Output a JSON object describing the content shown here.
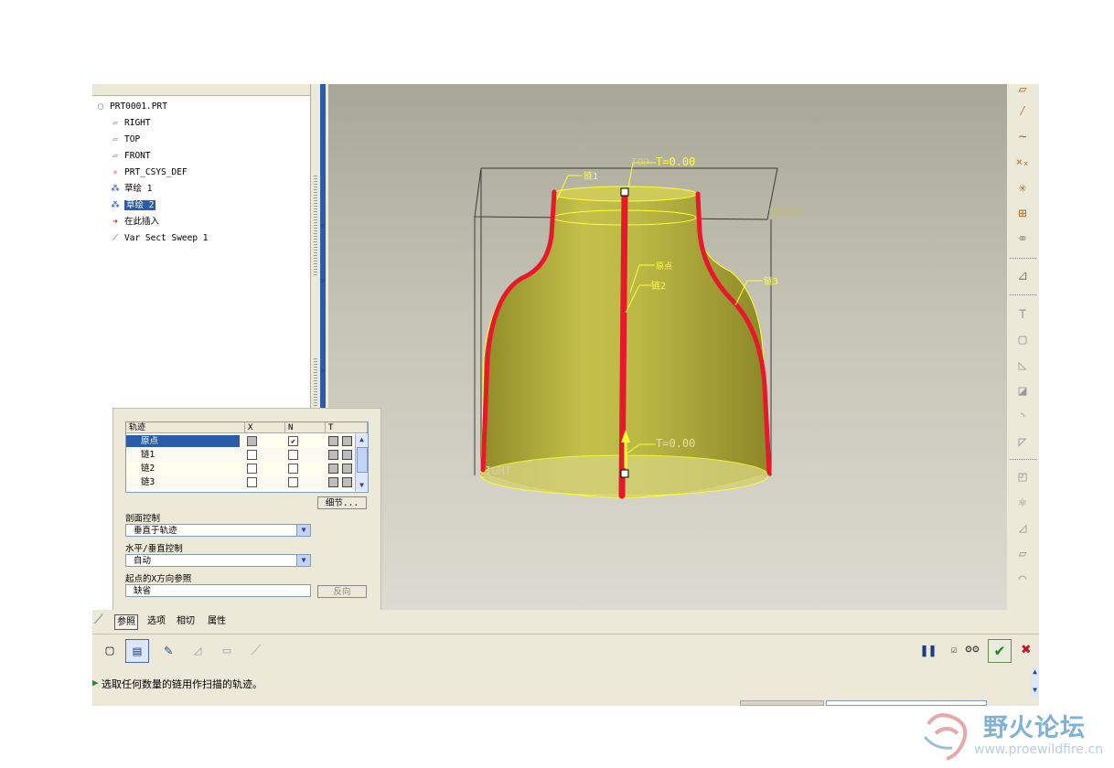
{
  "model_tree": {
    "items": [
      {
        "label": "PRT0001.PRT",
        "icon": "part-icon",
        "selected": false
      },
      {
        "label": "RIGHT",
        "icon": "datum-plane-icon",
        "selected": false
      },
      {
        "label": "TOP",
        "icon": "datum-plane-icon",
        "selected": false
      },
      {
        "label": "FRONT",
        "icon": "datum-plane-icon",
        "selected": false
      },
      {
        "label": "PRT_CSYS_DEF",
        "icon": "csys-icon",
        "selected": false
      },
      {
        "label": "草绘 1",
        "icon": "sketch-icon",
        "selected": false
      },
      {
        "label": "草绘 2",
        "icon": "sketch-icon",
        "selected": true
      },
      {
        "label": "在此插入",
        "icon": "insert-here-arrow-icon",
        "selected": false
      },
      {
        "label": "Var Sect Sweep 1",
        "icon": "sweep-feature-icon",
        "selected": false
      }
    ]
  },
  "viewport": {
    "labels": {
      "top_plane": "TOP",
      "t_top": "T=0.00",
      "front": "FRONT",
      "right": "IGHT",
      "chain1": "链1",
      "chain2": "链2",
      "chain3": "链3",
      "origin": "原点",
      "t_bottom": "T=0.00"
    },
    "colors": {
      "body": "#b9b43c",
      "trajectory": "#e8182c",
      "highlight": "#ffff33",
      "datum": "#3a3a3a"
    }
  },
  "dashboard": {
    "table": {
      "headers": [
        "轨迹",
        "X",
        "N",
        "T"
      ],
      "rows": [
        {
          "name": "原点",
          "x": "gray",
          "n": true,
          "selected": true
        },
        {
          "name": "链1",
          "x": false,
          "n": false,
          "selected": false
        },
        {
          "name": "链2",
          "x": false,
          "n": false,
          "selected": false
        },
        {
          "name": "链3",
          "x": false,
          "n": false,
          "selected": false
        }
      ]
    },
    "details_button": "细节...",
    "section_control_label": "剖面控制",
    "section_control_value": "垂直于轨迹",
    "hv_control_label": "水平/垂直控制",
    "hv_control_value": "自动",
    "x_ref_label": "起点的X方向参照",
    "x_ref_value": "缺省",
    "flip_button": "反向"
  },
  "tabs": [
    "参照",
    "选项",
    "相切",
    "属性"
  ],
  "message": "选取任何数量的链用作扫描的轨迹。",
  "watermark": {
    "title": "野火论坛",
    "url": "www.proewildfire.cn"
  }
}
